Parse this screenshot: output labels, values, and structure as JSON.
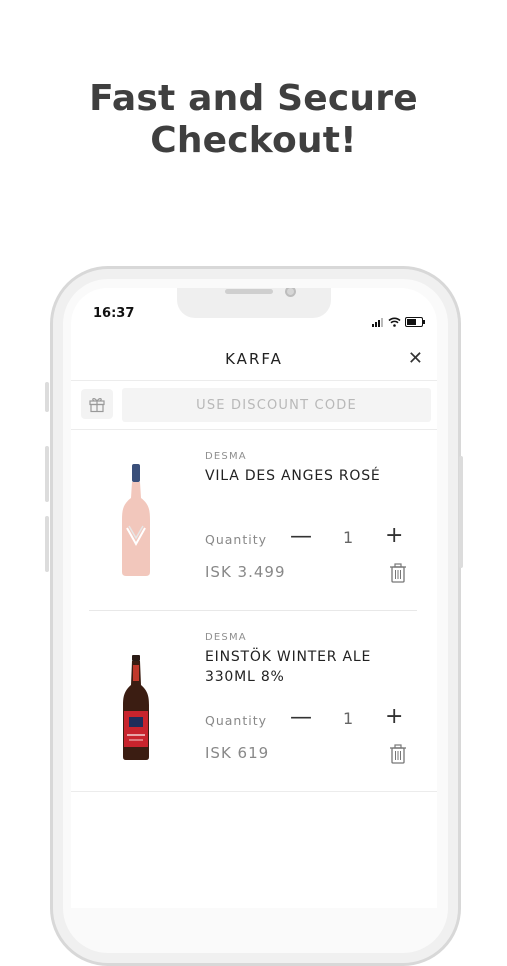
{
  "headline": {
    "line1": "Fast and Secure",
    "line2": "Checkout!"
  },
  "status_bar": {
    "time": "16:37"
  },
  "header": {
    "title": "KARFA",
    "close_icon": "close-icon"
  },
  "discount": {
    "placeholder": "USE DISCOUNT CODE",
    "icon": "gift-icon"
  },
  "cart": {
    "items": [
      {
        "brand": "DESMA",
        "name": "VILA DES ANGES ROSÉ",
        "quantity_label": "Quantity",
        "quantity": "1",
        "price": "ISK 3.499"
      },
      {
        "brand": "DESMA",
        "name": "EINSTÖK WINTER ALE 330ML 8%",
        "quantity_label": "Quantity",
        "quantity": "1",
        "price": "ISK 619"
      }
    ]
  },
  "colors": {
    "headline": "#3f3f3f",
    "muted_text": "#888888",
    "divider": "#ececec"
  }
}
